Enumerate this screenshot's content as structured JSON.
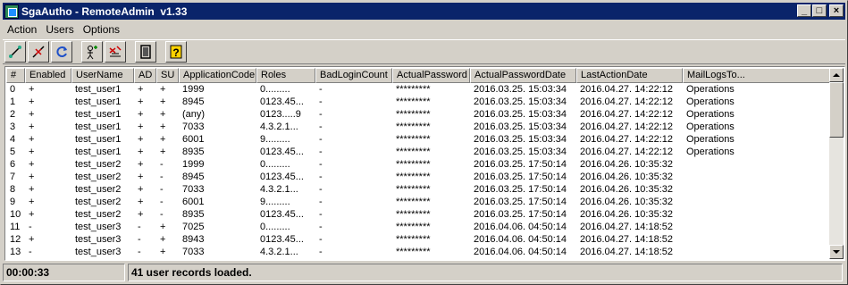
{
  "window": {
    "title": "SgaAutho - RemoteAdmin  v1.33",
    "buttons": {
      "minimize": "_",
      "maximize": "□",
      "close": "×"
    }
  },
  "menu": [
    "Action",
    "Users",
    "Options"
  ],
  "toolbar": [
    {
      "name": "connect-icon"
    },
    {
      "name": "disconnect-icon"
    },
    {
      "name": "refresh-icon"
    },
    {
      "name": "add-user-icon"
    },
    {
      "name": "remove-user-icon"
    },
    {
      "name": "exit-door-icon"
    },
    {
      "name": "help-icon"
    }
  ],
  "table": {
    "columns": [
      "#",
      "Enabled",
      "UserName",
      "AD",
      "SU",
      "ApplicationCode",
      "Roles",
      "BadLoginCount",
      "ActualPassword",
      "ActualPasswordDate",
      "LastActionDate",
      "MailLogsTo..."
    ],
    "rows": [
      [
        "0",
        "+",
        "test_user1",
        "+",
        "+",
        "1999",
        "0.........",
        "-",
        "*********",
        "2016.03.25. 15:03:34",
        "2016.04.27. 14:22:12",
        "Operations"
      ],
      [
        "1",
        "+",
        "test_user1",
        "+",
        "+",
        "8945",
        "0123.45...",
        "-",
        "*********",
        "2016.03.25. 15:03:34",
        "2016.04.27. 14:22:12",
        "Operations"
      ],
      [
        "2",
        "+",
        "test_user1",
        "+",
        "+",
        "(any)",
        "0123.....9",
        "-",
        "*********",
        "2016.03.25. 15:03:34",
        "2016.04.27. 14:22:12",
        "Operations"
      ],
      [
        "3",
        "+",
        "test_user1",
        "+",
        "+",
        "7033",
        "4.3.2.1...",
        "-",
        "*********",
        "2016.03.25. 15:03:34",
        "2016.04.27. 14:22:12",
        "Operations"
      ],
      [
        "4",
        "+",
        "test_user1",
        "+",
        "+",
        "6001",
        "9.........",
        "-",
        "*********",
        "2016.03.25. 15:03:34",
        "2016.04.27. 14:22:12",
        "Operations"
      ],
      [
        "5",
        "+",
        "test_user1",
        "+",
        "+",
        "8935",
        "0123.45...",
        "-",
        "*********",
        "2016.03.25. 15:03:34",
        "2016.04.27. 14:22:12",
        "Operations"
      ],
      [
        "6",
        "+",
        "test_user2",
        "+",
        "-",
        "1999",
        "0.........",
        "-",
        "*********",
        "2016.03.25. 17:50:14",
        "2016.04.26. 10:35:32",
        ""
      ],
      [
        "7",
        "+",
        "test_user2",
        "+",
        "-",
        "8945",
        "0123.45...",
        "-",
        "*********",
        "2016.03.25. 17:50:14",
        "2016.04.26. 10:35:32",
        ""
      ],
      [
        "8",
        "+",
        "test_user2",
        "+",
        "-",
        "7033",
        "4.3.2.1...",
        "-",
        "*********",
        "2016.03.25. 17:50:14",
        "2016.04.26. 10:35:32",
        ""
      ],
      [
        "9",
        "+",
        "test_user2",
        "+",
        "-",
        "6001",
        "9.........",
        "-",
        "*********",
        "2016.03.25. 17:50:14",
        "2016.04.26. 10:35:32",
        ""
      ],
      [
        "10",
        "+",
        "test_user2",
        "+",
        "-",
        "8935",
        "0123.45...",
        "-",
        "*********",
        "2016.03.25. 17:50:14",
        "2016.04.26. 10:35:32",
        ""
      ],
      [
        "11",
        "-",
        "test_user3",
        "-",
        "+",
        "7025",
        "0.........",
        "-",
        "*********",
        "2016.04.06. 04:50:14",
        "2016.04.27. 14:18:52",
        ""
      ],
      [
        "12",
        "+",
        "test_user3",
        "-",
        "+",
        "8943",
        "0123.45...",
        "-",
        "*********",
        "2016.04.06. 04:50:14",
        "2016.04.27. 14:18:52",
        ""
      ],
      [
        "13",
        "-",
        "test_user3",
        "-",
        "+",
        "7033",
        "4.3.2.1...",
        "-",
        "*********",
        "2016.04.06. 04:50:14",
        "2016.04.27. 14:18:52",
        ""
      ]
    ]
  },
  "status": {
    "timer": "00:00:33",
    "message": "41 user records loaded."
  }
}
